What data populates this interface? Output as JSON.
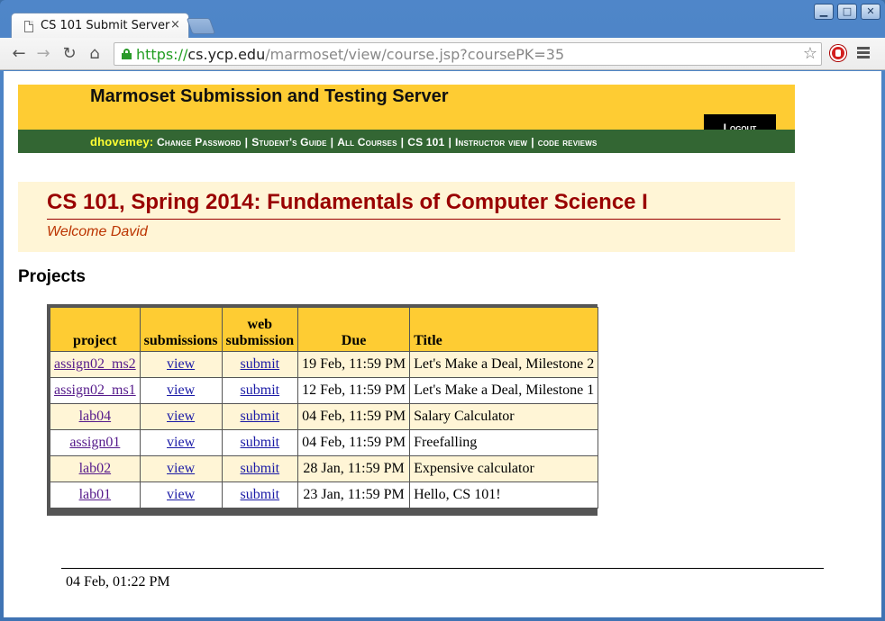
{
  "browser": {
    "tab_title": "CS 101 Submit Server",
    "tab_close": "×",
    "url": {
      "scheme": "https://",
      "host": "cs.ycp.edu",
      "path": "/marmoset/view/course.jsp?coursePK=35"
    },
    "icons": [
      "back-icon",
      "forward-icon",
      "reload-icon",
      "home-icon",
      "lock-icon",
      "bookmark-star-icon",
      "adblock-icon",
      "menu-icon"
    ]
  },
  "header": {
    "site_title": "Marmoset Submission and Testing Server",
    "username": "dhovemey:",
    "nav": {
      "change_password": "Change Password",
      "students_guide": "Student's Guide",
      "all_courses": "All Courses",
      "course": "CS 101",
      "instructor_view": "Instructor view",
      "code_reviews": "code reviews"
    },
    "separator": "|",
    "logout": "Logout"
  },
  "course": {
    "title": "CS 101, Spring 2014: Fundamentals of Computer Science I",
    "welcome": "Welcome David"
  },
  "projects": {
    "heading": "Projects",
    "columns": {
      "project": "project",
      "submissions": "submissions",
      "web_submission_1": "web",
      "web_submission_2": "submission",
      "due": "Due",
      "title": "Title"
    },
    "rows": [
      {
        "project": "assign02_ms2",
        "submissions": "view",
        "web": "submit",
        "due": "19 Feb, 11:59 PM",
        "title": "Let's Make a Deal, Milestone 2"
      },
      {
        "project": "assign02_ms1",
        "submissions": "view",
        "web": "submit",
        "due": "12 Feb, 11:59 PM",
        "title": "Let's Make a Deal, Milestone 1"
      },
      {
        "project": "lab04",
        "submissions": "view",
        "web": "submit",
        "due": "04 Feb, 11:59 PM",
        "title": "Salary Calculator"
      },
      {
        "project": "assign01",
        "submissions": "view",
        "web": "submit",
        "due": "04 Feb, 11:59 PM",
        "title": "Freefalling"
      },
      {
        "project": "lab02",
        "submissions": "view",
        "web": "submit",
        "due": "28 Jan, 11:59 PM",
        "title": "Expensive calculator"
      },
      {
        "project": "lab01",
        "submissions": "view",
        "web": "submit",
        "due": "23 Jan, 11:59 PM",
        "title": "Hello, CS 101!"
      }
    ]
  },
  "footer": {
    "timestamp": "04 Feb, 01:22 PM"
  },
  "colors": {
    "header_yellow": "#fecc33",
    "nav_green": "#336633",
    "course_title_red": "#990000",
    "row_tint": "#fff5d6"
  }
}
